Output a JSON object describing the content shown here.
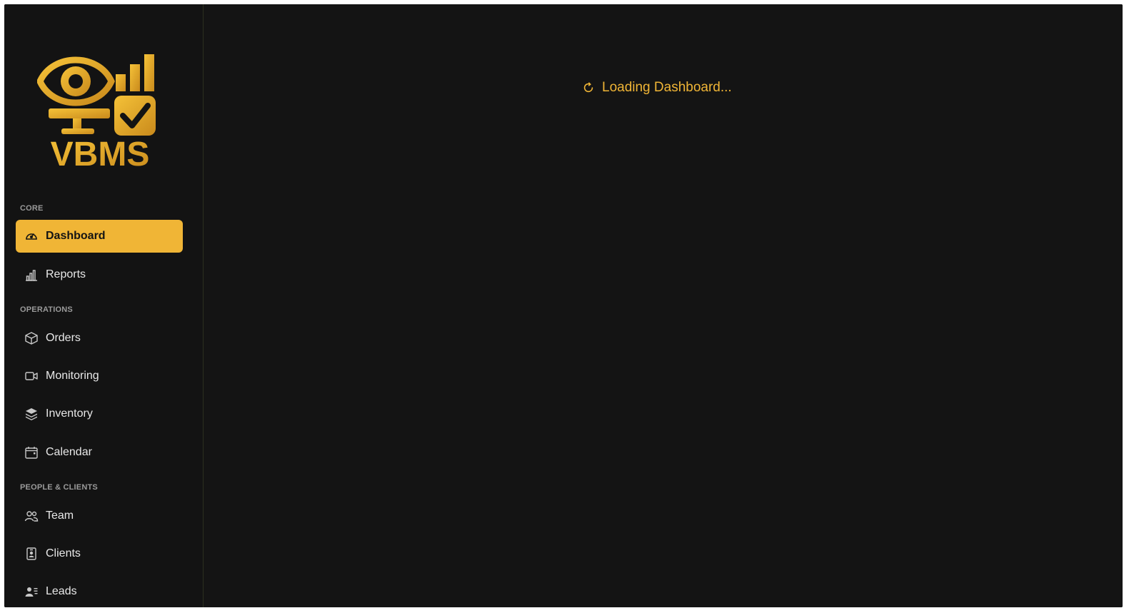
{
  "brand": {
    "name": "VBMS",
    "accent_color": "#f0b536"
  },
  "sidebar": {
    "sections": [
      {
        "label": "CORE",
        "items": [
          {
            "label": "Dashboard",
            "icon": "gauge-icon",
            "active": true
          },
          {
            "label": "Reports",
            "icon": "bar-chart-icon",
            "active": false
          }
        ]
      },
      {
        "label": "OPERATIONS",
        "items": [
          {
            "label": "Orders",
            "icon": "box-icon",
            "active": false
          },
          {
            "label": "Monitoring",
            "icon": "video-camera-icon",
            "active": false
          },
          {
            "label": "Inventory",
            "icon": "layers-icon",
            "active": false
          },
          {
            "label": "Calendar",
            "icon": "calendar-icon",
            "active": false
          }
        ]
      },
      {
        "label": "PEOPLE & CLIENTS",
        "items": [
          {
            "label": "Team",
            "icon": "people-icon",
            "active": false
          },
          {
            "label": "Clients",
            "icon": "person-badge-icon",
            "active": false
          },
          {
            "label": "Leads",
            "icon": "person-lines-icon",
            "active": false
          }
        ]
      }
    ]
  },
  "main": {
    "loading_text": "Loading Dashboard..."
  }
}
